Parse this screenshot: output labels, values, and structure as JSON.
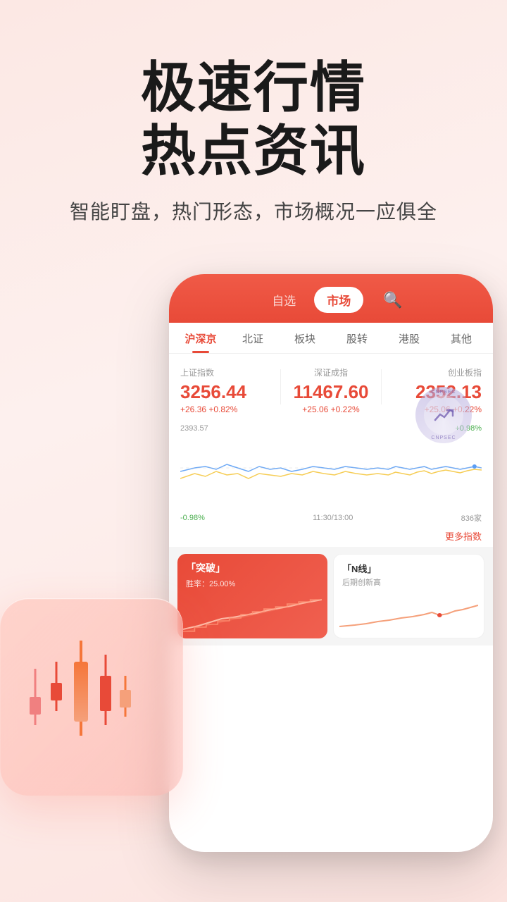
{
  "hero": {
    "title_line1": "极速行情",
    "title_line2": "热点资讯",
    "subtitle": "智能盯盘，热门形态，市场概况一应俱全"
  },
  "app": {
    "nav": {
      "item1": "自选",
      "item2": "市场",
      "active": "市场"
    },
    "tabs": [
      "沪深京",
      "北证",
      "板块",
      "股转",
      "港股",
      "其他"
    ],
    "active_tab": "沪深京"
  },
  "indices": [
    {
      "label": "上证指数",
      "value": "3256.44",
      "change": "+26.36  +0.82%",
      "color": "red"
    },
    {
      "label": "深证成指",
      "value": "11467.60",
      "change": "+25.06  +0.22%",
      "color": "red"
    },
    {
      "label": "创业板指",
      "value": "2352.13",
      "change": "+25.06  +0.22%",
      "color": "red"
    }
  ],
  "chart": {
    "top_label": "2393.57",
    "positive": "+0.98%",
    "negative": "-0.98%",
    "time": "11:30/13:00",
    "count": "836家",
    "more": "更多指数"
  },
  "cards": [
    {
      "type": "red",
      "title": "「突破」",
      "subtitle": "胜率：25.00%",
      "chart": "up"
    },
    {
      "type": "white",
      "title": "「N线」",
      "subtitle": "后期创新高",
      "chart": "up"
    }
  ],
  "stamp": {
    "text": "CNPSEC"
  }
}
